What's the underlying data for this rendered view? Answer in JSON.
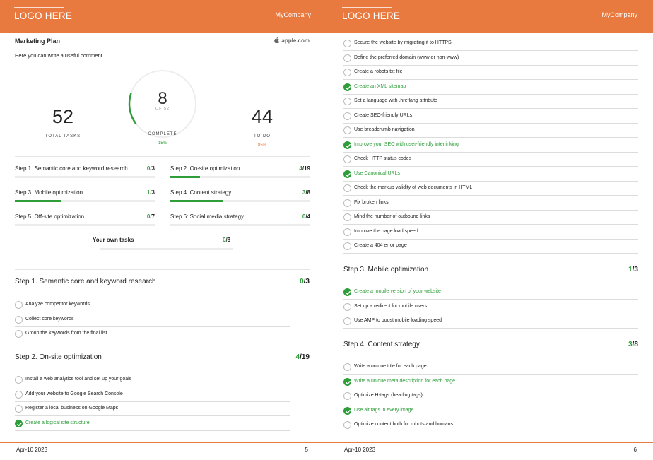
{
  "brand": {
    "logo_text": "LOGO HERE",
    "company": "MyCompany",
    "accent": "#e8793f",
    "done_color": "#2e9d3a",
    "ring_color": "#2e9d3a"
  },
  "pages": [
    {
      "date": "Apr-10 2023",
      "number": "5"
    },
    {
      "date": "Apr-10 2023",
      "number": "6"
    }
  ],
  "plan": {
    "title": "Marketing Plan",
    "source": "apple.com",
    "source_icon": "apple-icon",
    "comment": "Here you can write a useful comment",
    "stats": {
      "total_value": "52",
      "total_label": "TOTAL TASKS",
      "complete_value": "8",
      "complete_of": "OF 52",
      "complete_label": "COMPLETE",
      "complete_pct": "15%",
      "complete_fraction": 0.15,
      "todo_value": "44",
      "todo_label": "TO DO",
      "todo_pct": "85%"
    }
  },
  "summary": [
    {
      "name": "Step 1. Semantic core and keyword research",
      "done": "0",
      "total": "/3",
      "progress": 0.0
    },
    {
      "name": "Step 2. On-site optimization",
      "done": "4",
      "total": "/19",
      "progress": 0.21
    },
    {
      "name": "Step 3. Mobile optimization",
      "done": "1",
      "total": "/3",
      "progress": 0.33
    },
    {
      "name": "Step 4. Content strategy",
      "done": "3",
      "total": "/8",
      "progress": 0.375
    },
    {
      "name": "Step 5. Off-site optimization",
      "done": "0",
      "total": "/7",
      "progress": 0.0
    },
    {
      "name": "Step 6: Social media strategy",
      "done": "0",
      "total": "/4",
      "progress": 0.0
    }
  ],
  "own_tasks": {
    "label": "Your own tasks",
    "done": "0",
    "total": "/8",
    "progress": 0.0
  },
  "sections": {
    "step1": {
      "title": "Step 1. Semantic core and keyword research",
      "done": "0",
      "total": "/3",
      "tasks": [
        {
          "text": "Analyze competitor keywords",
          "checked": false
        },
        {
          "text": "Collect core keywords",
          "checked": false
        },
        {
          "text": "Group the keywords from the final list",
          "checked": false
        }
      ]
    },
    "step2": {
      "title": "Step 2. On-site optimization",
      "done": "4",
      "total": "/19",
      "tasks": [
        {
          "text": "Install a web analytics tool and set up your goals",
          "checked": false
        },
        {
          "text": "Add your website to Google Search Console",
          "checked": false
        },
        {
          "text": "Register a local business on Google Maps",
          "checked": false
        },
        {
          "text": "Create a logical site structure",
          "checked": true
        }
      ]
    },
    "step2_cont": {
      "tasks": [
        {
          "text": "Secure the website by migrating it to HTTPS",
          "checked": false
        },
        {
          "text": "Define the preferred domain (www or non-www)",
          "checked": false
        },
        {
          "text": "Create a robots.txt file",
          "checked": false
        },
        {
          "text": "Create an XML sitemap",
          "checked": true
        },
        {
          "text": "Set a language with .hreflang attribute",
          "checked": false
        },
        {
          "text": "Create SEO-friendly URLs",
          "checked": false
        },
        {
          "text": "Use breadcrumb navigation",
          "checked": false
        },
        {
          "text": "Improve your SEO with user-friendly interlinking",
          "checked": true
        },
        {
          "text": "Check HTTP status codes",
          "checked": false
        },
        {
          "text": "Use Canonical URLs",
          "checked": true
        },
        {
          "text": "Check the markup validity of web documents in HTML",
          "checked": false
        },
        {
          "text": "Fix broken links",
          "checked": false
        },
        {
          "text": "Mind the number of outbound links",
          "checked": false
        },
        {
          "text": "Improve the page load speed",
          "checked": false
        },
        {
          "text": "Create a 404 error page",
          "checked": false
        }
      ]
    },
    "step3": {
      "title": "Step 3. Mobile optimization",
      "done": "1",
      "total": "/3",
      "tasks": [
        {
          "text": "Create a mobile version of your website",
          "checked": true
        },
        {
          "text": "Set up a redirect for mobile users",
          "checked": false
        },
        {
          "text": "Use AMP to boost mobile loading speed",
          "checked": false
        }
      ]
    },
    "step4": {
      "title": "Step 4. Content strategy",
      "done": "3",
      "total": "/8",
      "tasks": [
        {
          "text": "Write a unique title for each page",
          "checked": false
        },
        {
          "text": "Write a unique meta description for each page",
          "checked": true
        },
        {
          "text": "Optimize H-tags (heading tags)",
          "checked": false
        },
        {
          "text": "Use alt tags in every image",
          "checked": true
        },
        {
          "text": "Optimize content both for robots and humans",
          "checked": false
        }
      ]
    }
  }
}
